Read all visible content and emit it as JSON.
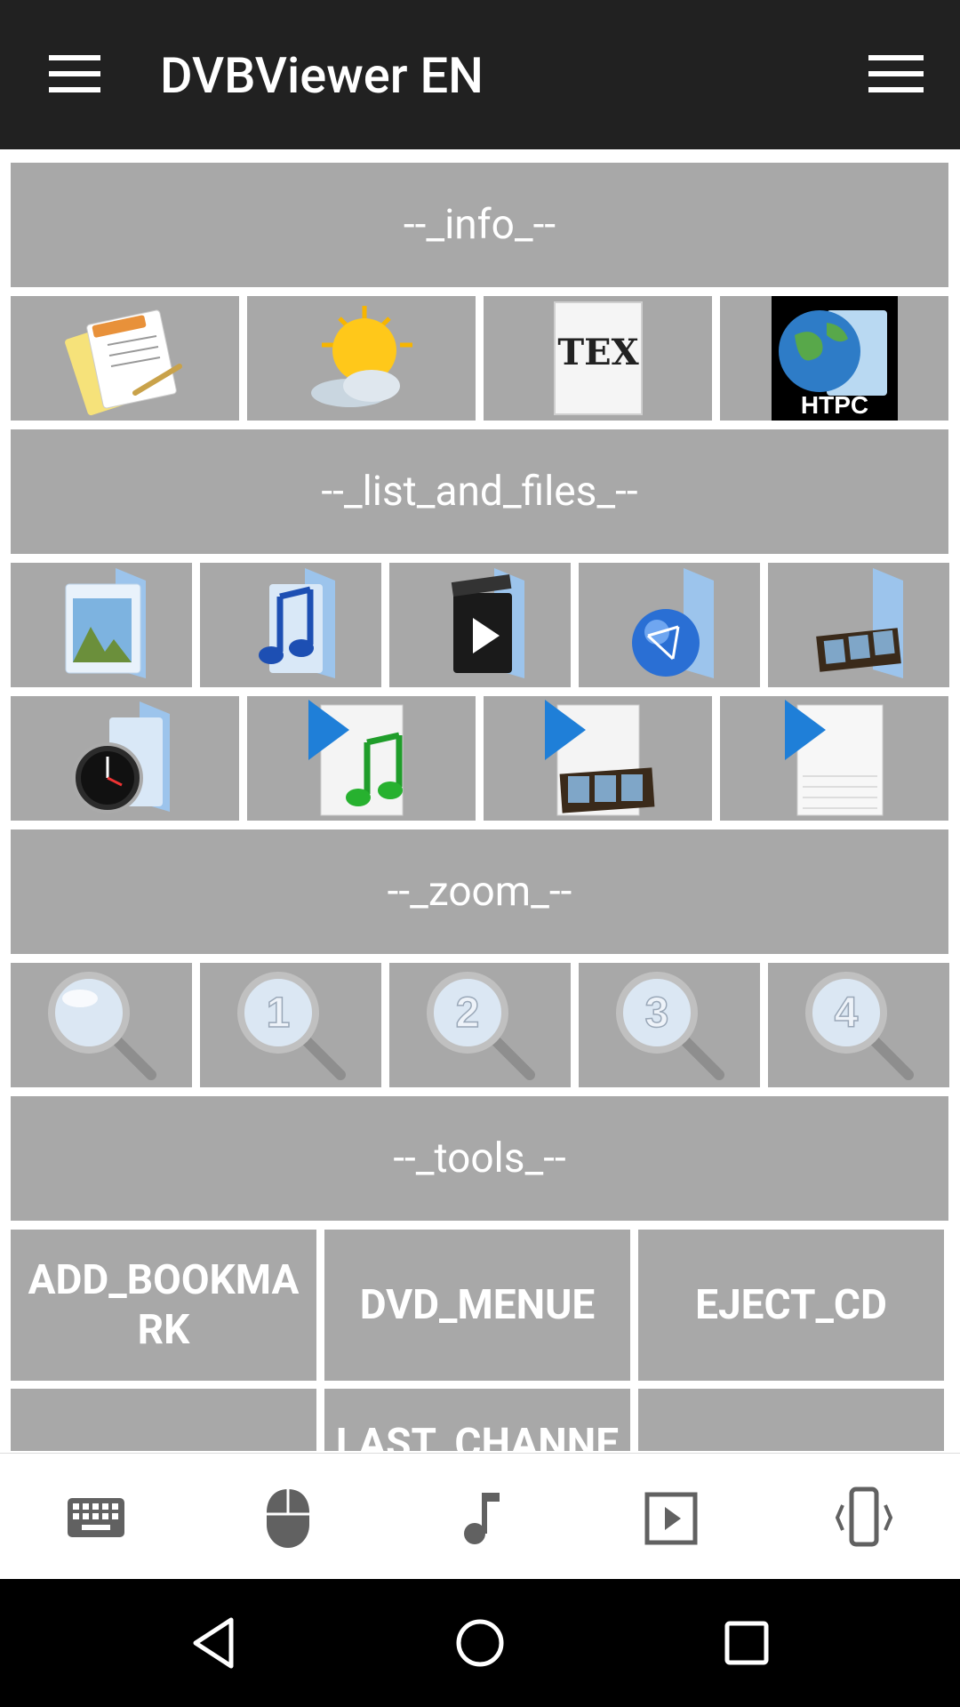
{
  "app_bar": {
    "title": "DVBViewer EN"
  },
  "sections": {
    "info": "--_info_--",
    "list_and_files": "--_list_and_files_--",
    "zoom": "--_zoom_--",
    "tools": "--_tools_--"
  },
  "info_icons": [
    "word-document-icon",
    "weather-icon",
    "tex-icon",
    "htpc-globe-folder-icon"
  ],
  "tex_label": "TEX",
  "htpc_label": "HTPC",
  "files_icons_row1": [
    "photos-folder-icon",
    "music-folder-icon",
    "video-folder-icon",
    "network-folder-icon",
    "film-folder-icon"
  ],
  "files_icons_row2": [
    "recent-folder-icon",
    "music-playlist-icon",
    "video-playlist-icon",
    "playlist-icon"
  ],
  "zoom_icons": [
    "zoom-icon",
    "zoom-1-icon",
    "zoom-2-icon",
    "zoom-3-icon",
    "zoom-4-icon"
  ],
  "zoom_numbers": [
    "1",
    "2",
    "3",
    "4"
  ],
  "tools_buttons": {
    "add_bookmark": "ADD_BOOKMARK",
    "dvd_menue": "DVD_MENUE",
    "eject_cd": "EJECT_CD",
    "last_channel": "LAST_CHANNE"
  },
  "bottom_nav": [
    "keyboard-icon",
    "mouse-icon",
    "music-note-icon",
    "play-icon",
    "vibrate-phone-icon"
  ],
  "colors": {
    "app_bar": "#212121",
    "tile": "#a8a8a8",
    "nav_bar": "#000000",
    "icon_gray": "#616161"
  }
}
